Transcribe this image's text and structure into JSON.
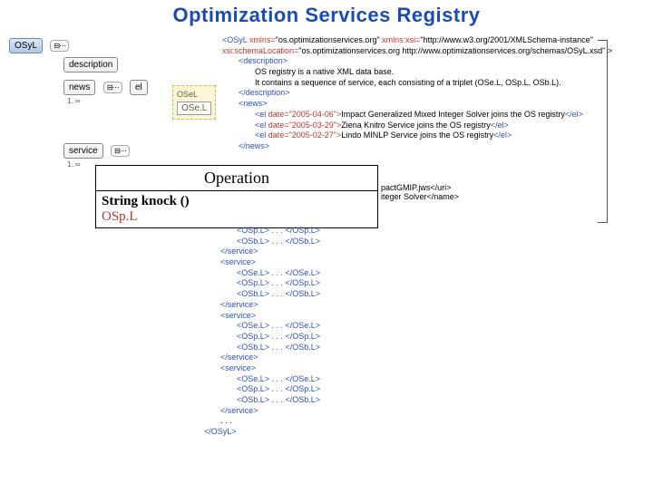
{
  "title": "Optimization Services Registry",
  "schema": {
    "root": "OSyL",
    "description_node": "description",
    "news_node": "news",
    "el_node": "el",
    "el_card": "1..∞",
    "osel_group": "OSeL",
    "osel_inner": "OSe.L",
    "service_node": "service",
    "service_card": "1..∞"
  },
  "operation": {
    "header": "Operation",
    "signature": "String knock ()",
    "return": "OSp.L"
  },
  "xml": {
    "open_osyl1": "<OSyL ",
    "open_osyl2": "xmlns=",
    "open_osyl2v": "\"os.optimizationservices.org\" ",
    "open_osyl3": "xmlns:xsi=",
    "open_osyl3v": "\"http://www.w3.org/2001/XMLSchema-instance\"",
    "open_osyl4": "xsi:schemaLocation=",
    "open_osyl4v": "\"os.optimizationservices.org http://www.optimizationservices.org/schemas/OSyL.xsd\" >",
    "desc_open": "<description>",
    "desc_text1": "OS registry is a native XML data base.",
    "desc_text2": "It contains a sequence of service, each consisting of a triplet (OSe.L, OSp.L, OSb.L).",
    "desc_close": "</description>",
    "news_open": "<news>",
    "el1_open": "<el ",
    "el1_attr": "date=\"2005-04-06\">",
    "el1_txt": "Impact Generalized Mixed Integer Solver joins the OS registry",
    "el_close": "</el>",
    "el2_open": "<el ",
    "el2_attr": "date=\"2005-03-29\">",
    "el2_txt": "Ziena Knitro Service joins the OS registry",
    "el3_open": "<el ",
    "el3_attr": "date=\"2005-02-27\">",
    "el3_txt": "Lindo MINLP Service joins the OS registry",
    "news_close": "</news>",
    "uri_tail": "pactGMIP.jws</uri>",
    "name_tail": "iteger Solver</name>",
    "ose_frag": "<OSe.L> . . . </OSe.L>",
    "osp_frag": "<OSp.L> . . . </OSp.L>",
    "osb_frag": "<OSb.L> . . . </OSb.L>",
    "service_close": "</service>",
    "service_open": "<service>",
    "dots": ". . .",
    "close_osyl": "</OSyL>"
  }
}
